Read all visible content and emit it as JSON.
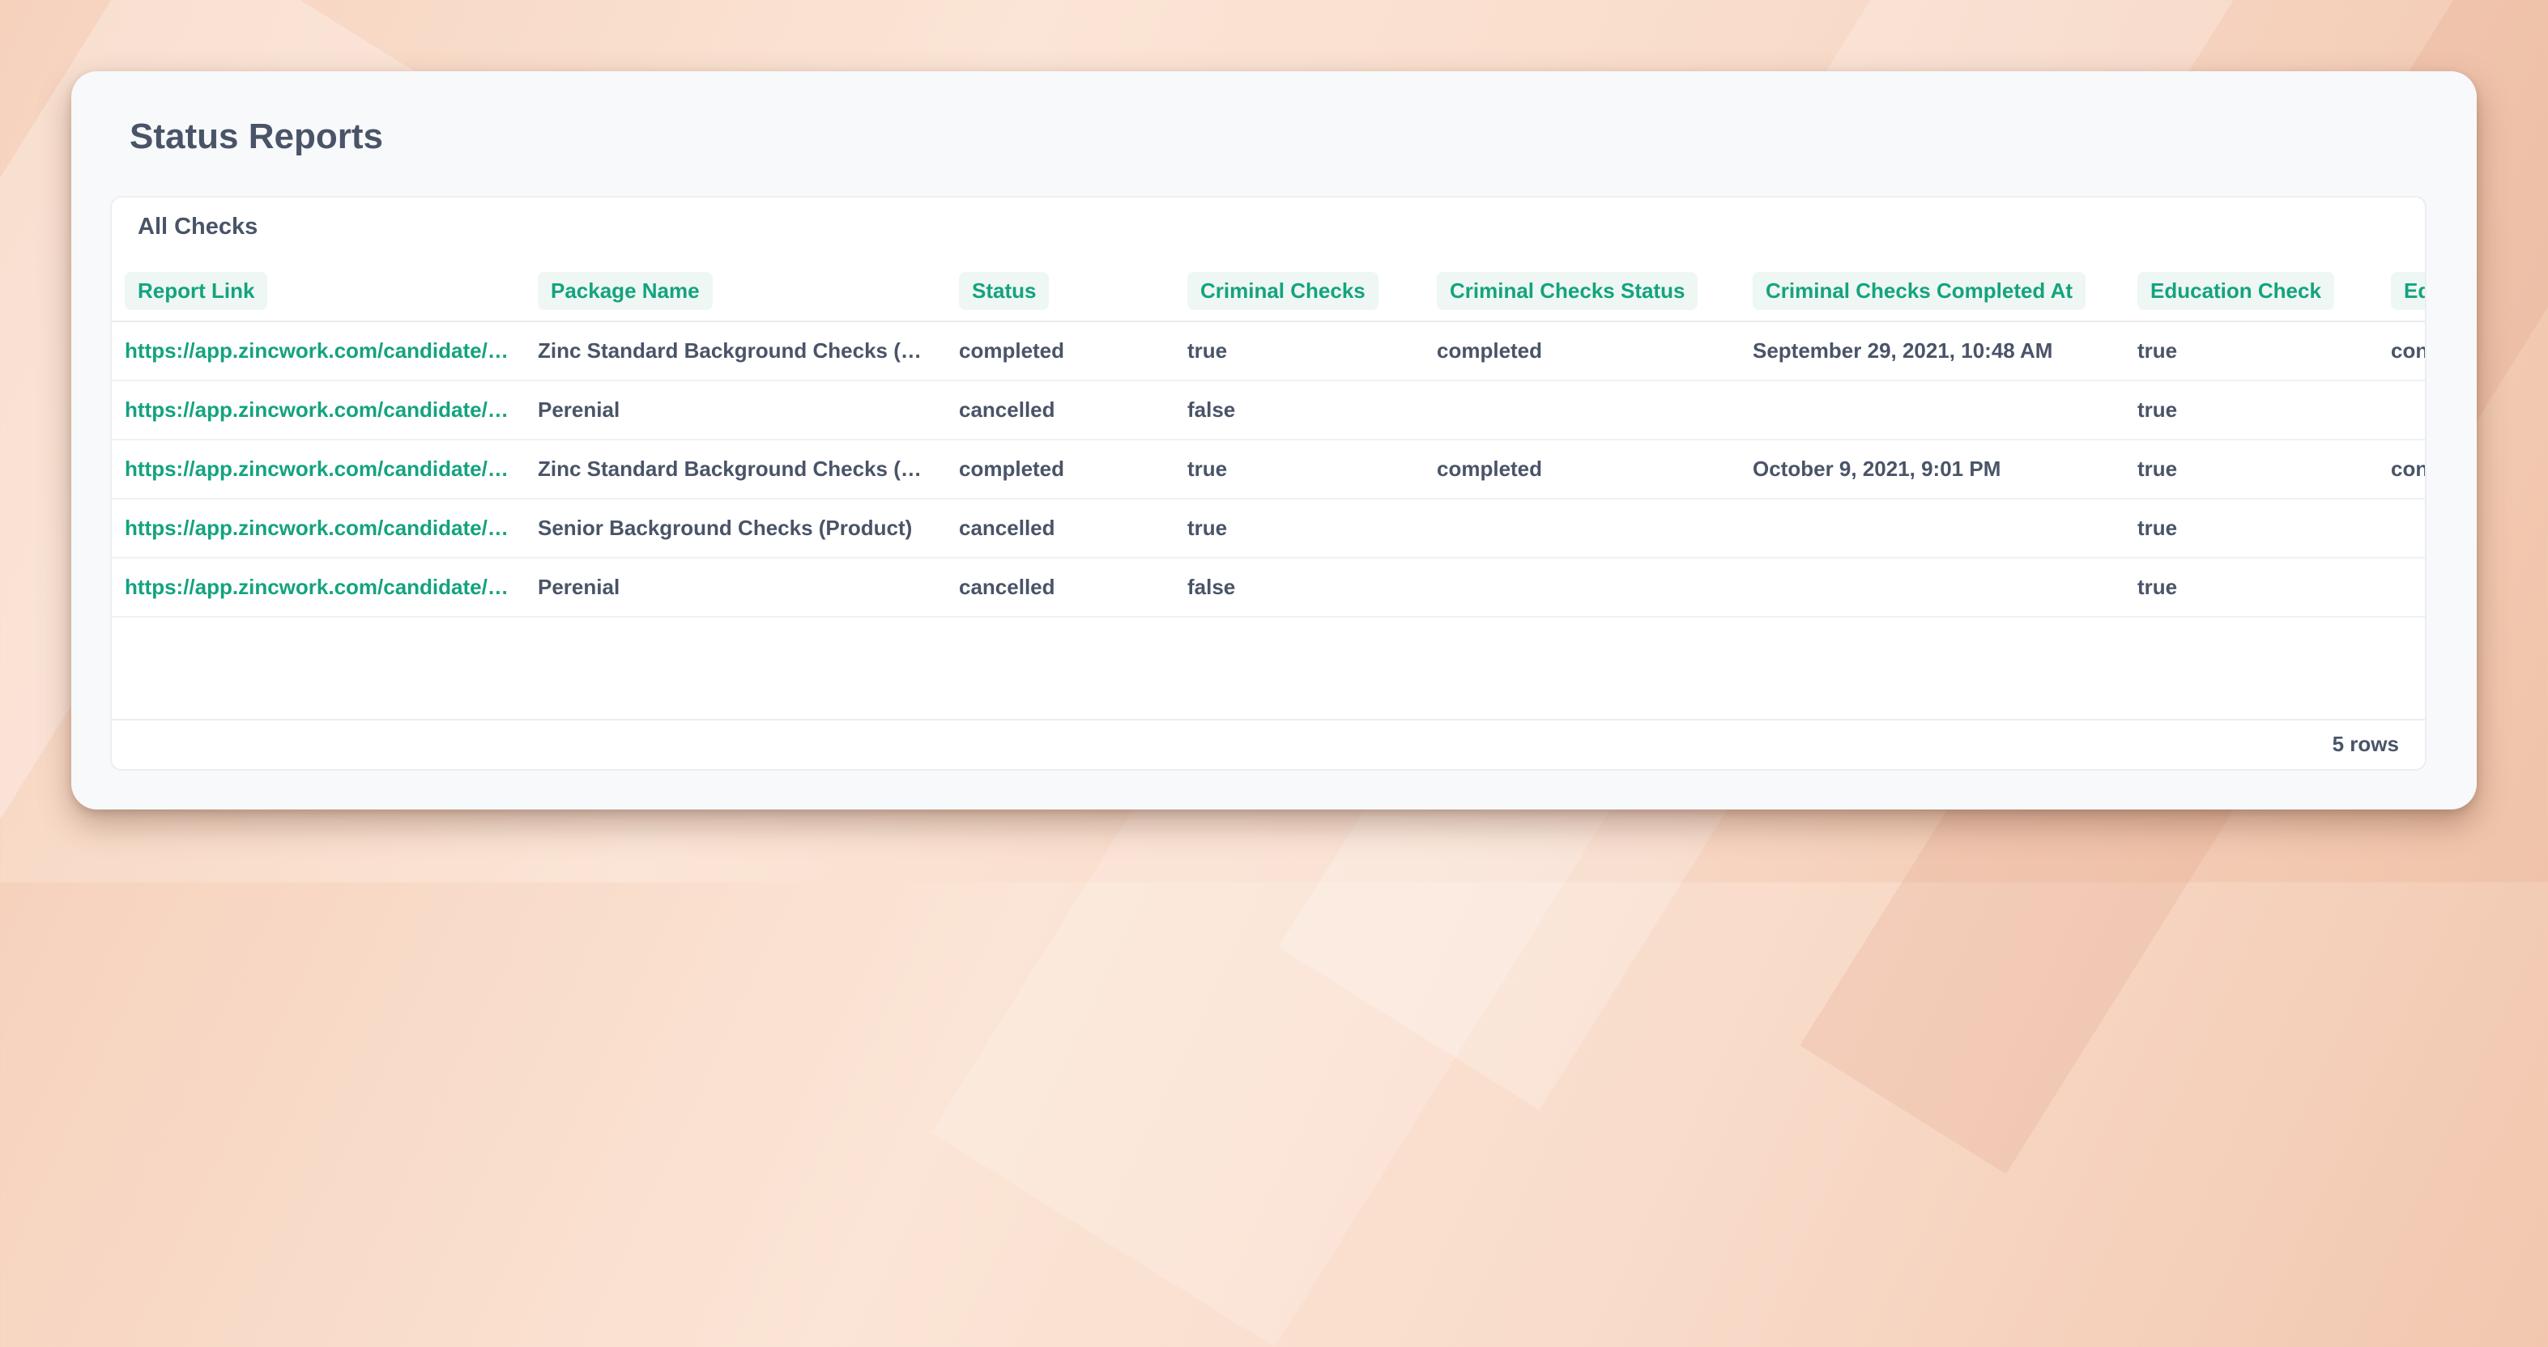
{
  "page": {
    "title": "Status Reports"
  },
  "panel": {
    "title": "All Checks",
    "row_count": "5 rows",
    "columns": [
      "Report Link",
      "Package Name",
      "Status",
      "Criminal Checks",
      "Criminal Checks Status",
      "Criminal Checks Completed At",
      "Education Check",
      "Ed"
    ],
    "rows": [
      [
        "https://app.zincwork.com/candidate/…",
        "Zinc Standard Background Checks (…",
        "completed",
        "true",
        "completed",
        "September 29, 2021, 10:48 AM",
        "true",
        "con"
      ],
      [
        "https://app.zincwork.com/candidate/…",
        "Perenial",
        "cancelled",
        "false",
        "",
        "",
        "true",
        ""
      ],
      [
        "https://app.zincwork.com/candidate/…",
        "Zinc Standard Background Checks (…",
        "completed",
        "true",
        "completed",
        "October 9, 2021, 9:01 PM",
        "true",
        "con"
      ],
      [
        "https://app.zincwork.com/candidate/…",
        "Senior Background Checks (Product)",
        "cancelled",
        "true",
        "",
        "",
        "true",
        ""
      ],
      [
        "https://app.zincwork.com/candidate/…",
        "Perenial",
        "cancelled",
        "false",
        "",
        "",
        "true",
        ""
      ]
    ]
  },
  "colors": {
    "accent": "#14a37f",
    "text": "#4a5468",
    "card": "#f8f9fb"
  }
}
